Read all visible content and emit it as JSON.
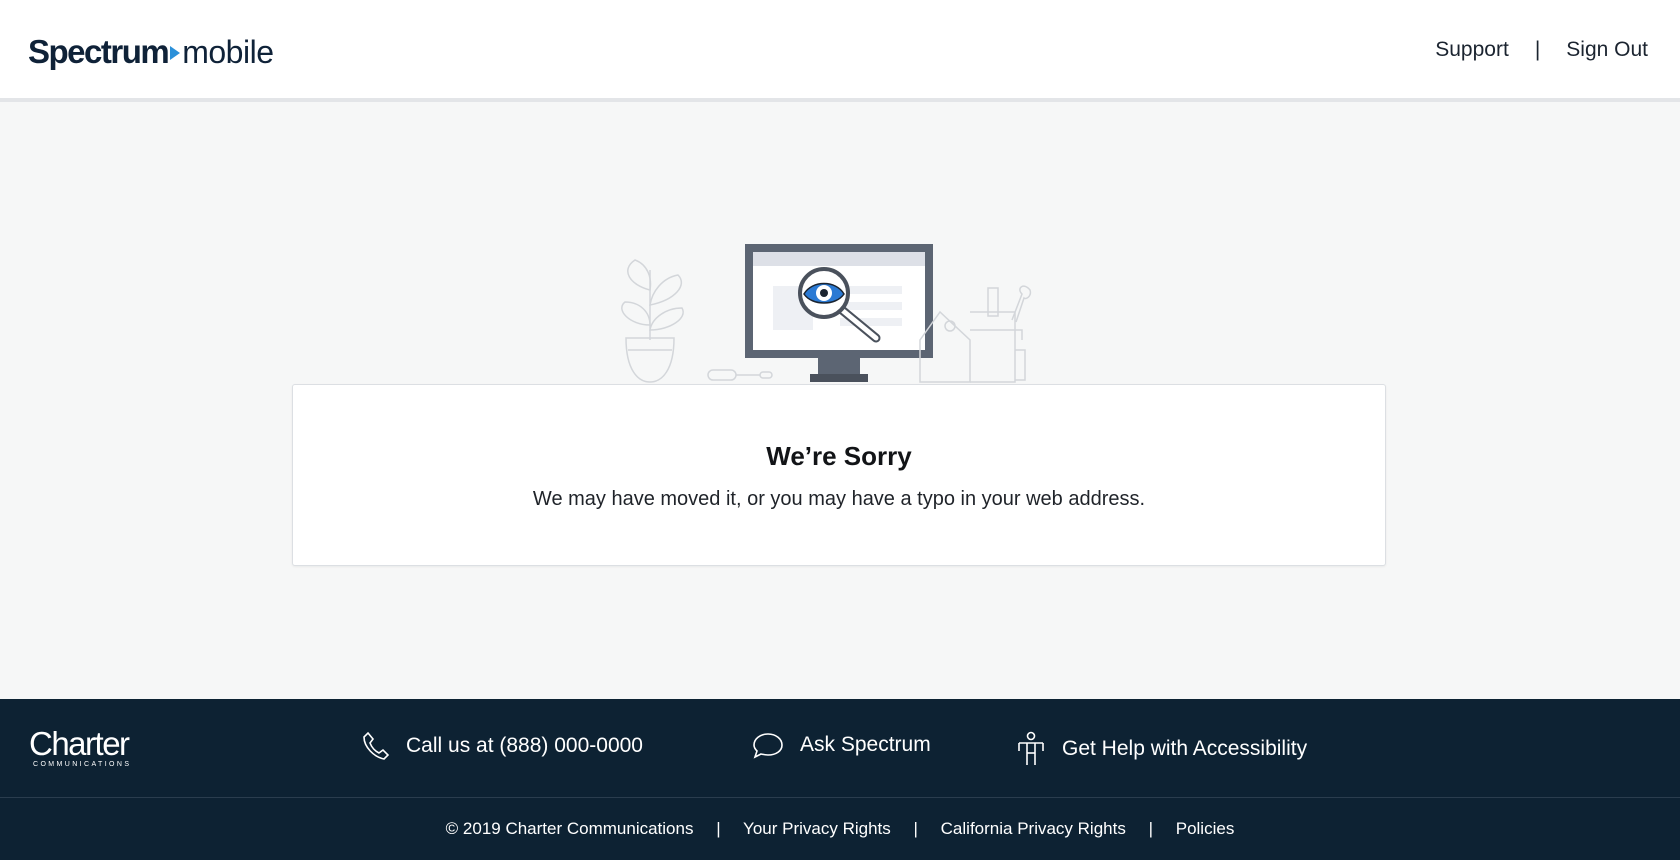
{
  "header": {
    "logo_brand": "Spectrum",
    "logo_sub": "mobile",
    "nav": {
      "support": "Support",
      "separator": "|",
      "sign_out": "Sign Out"
    }
  },
  "error": {
    "title": "We’re Sorry",
    "message": "We may have moved it, or you may have a typo in your web address."
  },
  "footer": {
    "logo_name": "Charter",
    "logo_sub": "COMMUNICATIONS",
    "call": "Call us at (888) 000-0000",
    "ask": "Ask Spectrum",
    "accessibility": "Get Help with Accessibility",
    "copyright": "© 2019 Charter Communications",
    "privacy": "Your Privacy Rights",
    "california": "California Privacy Rights",
    "policies": "Policies",
    "separator": "|"
  },
  "colors": {
    "brand_navy": "#0f2238",
    "brand_blue": "#2b90d9",
    "footer_bg": "#0d2233",
    "page_bg": "#f6f7f7"
  },
  "icons": [
    "phone-icon",
    "chat-bubble-icon",
    "accessibility-icon",
    "magnifier-eye-icon"
  ]
}
